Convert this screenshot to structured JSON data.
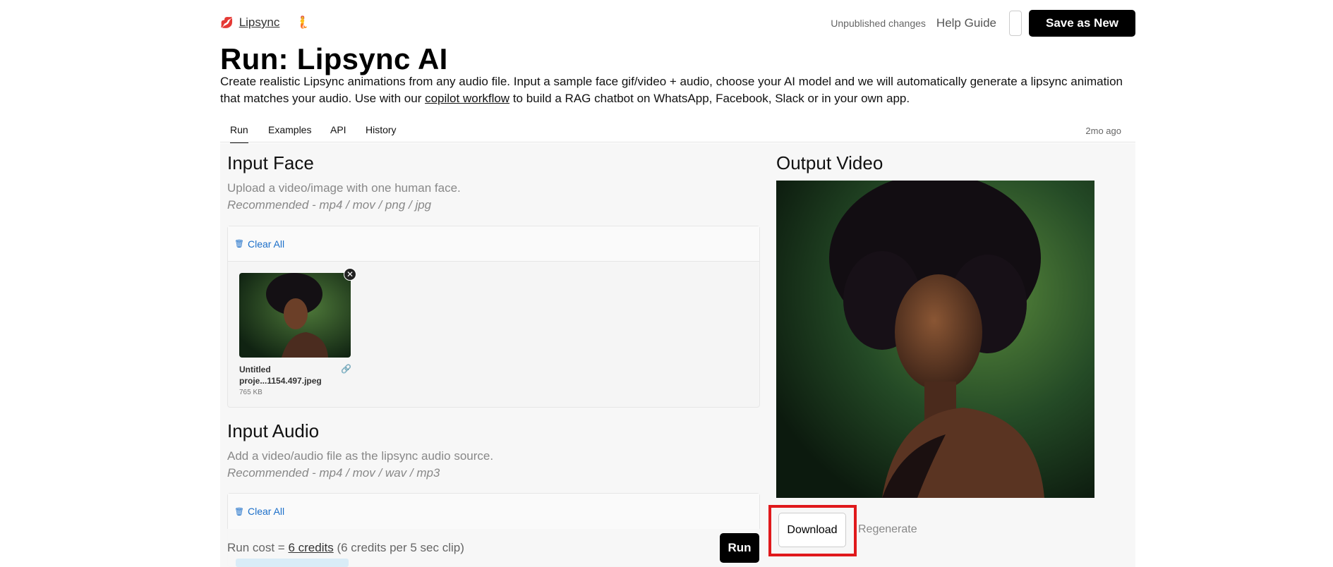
{
  "header": {
    "brand_emoji": "💋",
    "brand_label": "Lipsync",
    "brand_icon": "🧜",
    "unpublished": "Unpublished changes",
    "help": "Help Guide",
    "save_label": "Save as New"
  },
  "page": {
    "title": "Run: Lipsync AI",
    "desc_pre": "Create realistic Lipsync animations from any audio file. Input a sample face gif/video + audio, choose your AI model and we will automatically generate a lipsync animation that matches your audio. Use with our ",
    "desc_link": "copilot workflow",
    "desc_post": " to build a RAG chatbot on WhatsApp, Facebook, Slack or in your own app."
  },
  "tabs": [
    {
      "label": "Run"
    },
    {
      "label": "Examples"
    },
    {
      "label": "API"
    },
    {
      "label": "History"
    }
  ],
  "updated": "2mo ago",
  "input_face": {
    "title": "Input Face",
    "sub1": "Upload a video/image with one human face.",
    "sub2": "Recommended - mp4 / mov / png / jpg",
    "clear_label": "Clear All",
    "file_name": "Untitled proje...1154.497.jpeg",
    "file_size": "765 KB"
  },
  "input_audio": {
    "title": "Input Audio",
    "sub1": "Add a video/audio file as the lipsync audio source.",
    "sub2": "Recommended - mp4 / mov / wav / mp3",
    "clear_label": "Clear All"
  },
  "footer": {
    "cost_pre": "Run cost = ",
    "cost_link": "6 credits",
    "cost_post": " (6 credits per 5 sec clip)",
    "run_label": "Run"
  },
  "output": {
    "title": "Output Video",
    "download_label": "Download",
    "regenerate_label": "Regenerate"
  },
  "colors": {
    "accent_link": "#1c6fc9",
    "highlight": "#e0191c",
    "button_dark": "#000000"
  }
}
